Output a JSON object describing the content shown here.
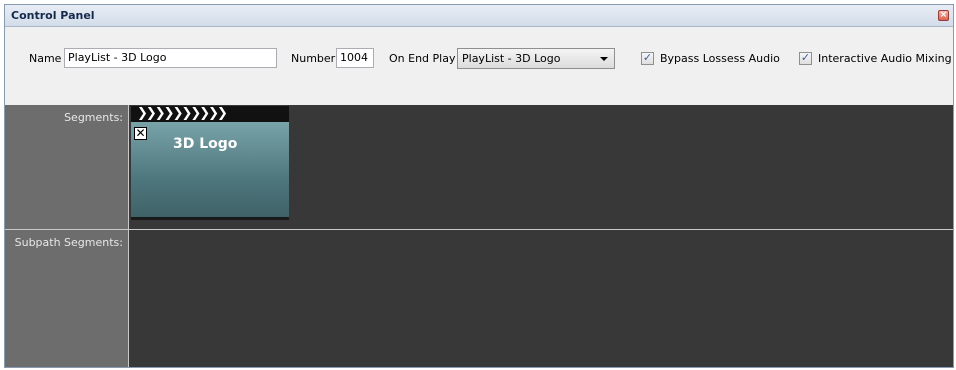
{
  "window": {
    "title": "Control Panel",
    "close_glyph": "×"
  },
  "toolbar": {
    "name_label": "Name",
    "name_value": "PlayList - 3D Logo",
    "number_label": "Number",
    "number_value": "1004",
    "on_end_play_label": "On End Play",
    "on_end_play_value": "PlayList - 3D Logo",
    "bypass_label": "Bypass Lossess Audio",
    "bypass_checked": true,
    "interactive_label": "Interactive Audio Mixing",
    "interactive_checked": true,
    "check_glyph": "✓"
  },
  "timeline": {
    "segments_label": "Segments:",
    "subpath_label": "Subpath Segments:",
    "clip": {
      "title": "3D Logo",
      "close_glyph": "✕",
      "stripes": "❯❯❯❯❯❯❯❯❯❯"
    }
  },
  "icons": [
    "close-icon",
    "checkbox-check-icon",
    "dropdown-arrow-icon",
    "clapperboard-icon",
    "clip-close-icon"
  ],
  "colors": {
    "track_bg": "#383838",
    "label_col_bg": "#6d6d6d",
    "clip_color": "#5a868c"
  }
}
